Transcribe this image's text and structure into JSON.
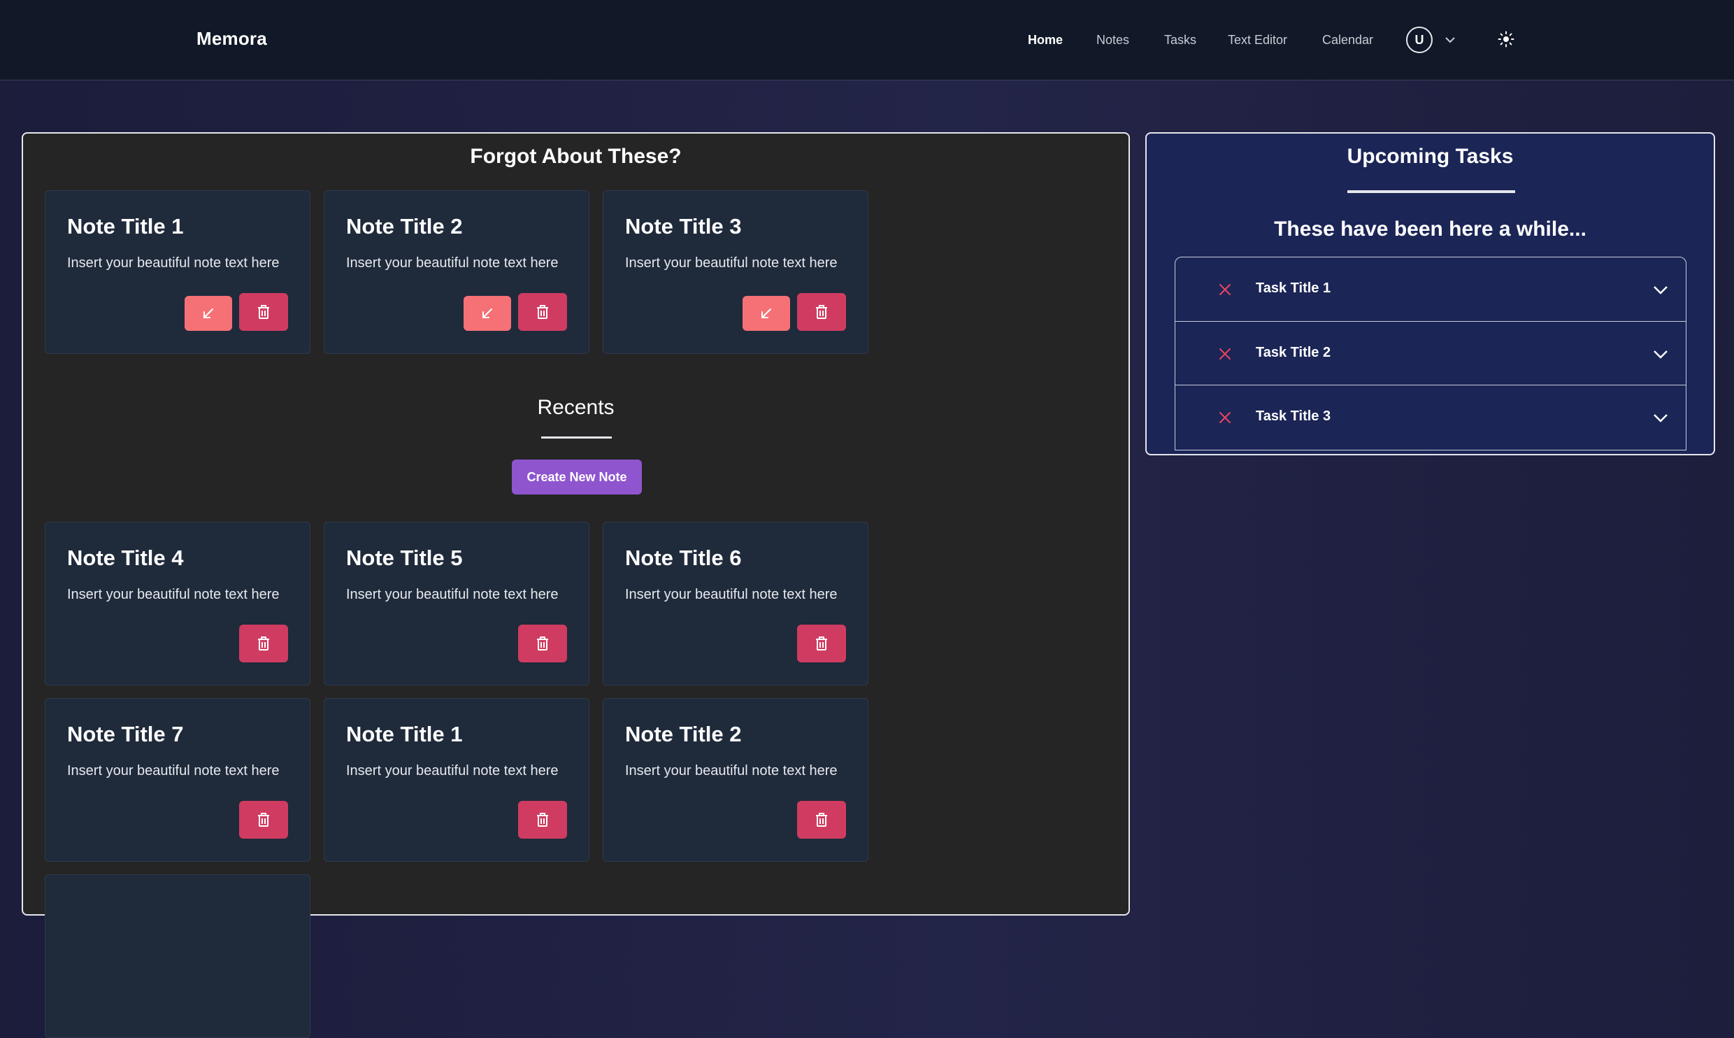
{
  "header": {
    "brand": "Memora",
    "nav": [
      {
        "label": "Home",
        "active": true
      },
      {
        "label": "Notes",
        "active": false
      },
      {
        "label": "Tasks",
        "active": false
      },
      {
        "label": "Text Editor",
        "active": false
      },
      {
        "label": "Calendar",
        "active": false
      }
    ],
    "avatar_initial": "U",
    "icons": {
      "caret": "chevron-down-icon",
      "theme": "sun-icon"
    }
  },
  "forgot": {
    "title": "Forgot About These?",
    "notes": [
      {
        "title": "Note Title 1",
        "text": "Insert your beautiful note text here"
      },
      {
        "title": "Note Title 2",
        "text": "Insert your beautiful note text here"
      },
      {
        "title": "Note Title 3",
        "text": "Insert your beautiful note text here"
      }
    ]
  },
  "recents": {
    "title": "Recents",
    "create_label": "Create New Note",
    "notes": [
      {
        "title": "Note Title 4",
        "text": "Insert your beautiful note text here"
      },
      {
        "title": "Note Title 5",
        "text": "Insert your beautiful note text here"
      },
      {
        "title": "Note Title 6",
        "text": "Insert your beautiful note text here"
      },
      {
        "title": "Note Title 7",
        "text": "Insert your beautiful note text here"
      },
      {
        "title": "Note Title 1",
        "text": "Insert your beautiful note text here"
      },
      {
        "title": "Note Title 2",
        "text": "Insert your beautiful note text here"
      }
    ]
  },
  "tasks": {
    "title": "Upcoming Tasks",
    "subtitle": "These have been here a while...",
    "items": [
      {
        "label": "Task Title 1"
      },
      {
        "label": "Task Title 2"
      },
      {
        "label": "Task Title 3"
      }
    ]
  },
  "colors": {
    "accent_purple": "#8f55cf",
    "restore": "#f67175",
    "delete": "#d03c61",
    "task_x": "#e8455f"
  }
}
